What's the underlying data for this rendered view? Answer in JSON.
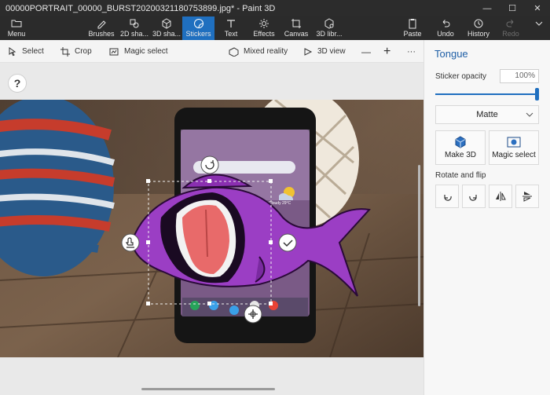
{
  "window": {
    "title": "00000PORTRAIT_00000_BURST20200321180753899.jpg* - Paint 3D",
    "controls": [
      "—",
      "☐",
      "✕"
    ]
  },
  "ribbon": {
    "menu": "Menu",
    "brushes": "Brushes",
    "shapes_2d": "2D sha...",
    "shapes_3d": "3D sha...",
    "stickers": "Stickers",
    "text": "Text",
    "effects": "Effects",
    "canvas": "Canvas",
    "library_3d": "3D libr...",
    "paste": "Paste",
    "undo": "Undo",
    "history": "History",
    "redo": "Redo",
    "active_tab": "Stickers",
    "accent_color": "#1f6fbf"
  },
  "toolbar": {
    "select": "Select",
    "crop": "Crop",
    "magic_select": "Magic select",
    "mixed_reality": "Mixed reality",
    "view_3d": "3D view",
    "zoom_out": "—",
    "zoom_in": "+",
    "more": "···"
  },
  "canvas": {
    "help": "?",
    "phone_text": {
      "weather": "Cloudy 29°C"
    }
  },
  "panel": {
    "title": "Tongue",
    "opacity_label": "Sticker opacity",
    "opacity_value": "100%",
    "opacity_level": 1.0,
    "finish_value": "Matte",
    "make_3d": "Make 3D",
    "magic_select": "Magic select",
    "rotate_flip_label": "Rotate and flip"
  }
}
